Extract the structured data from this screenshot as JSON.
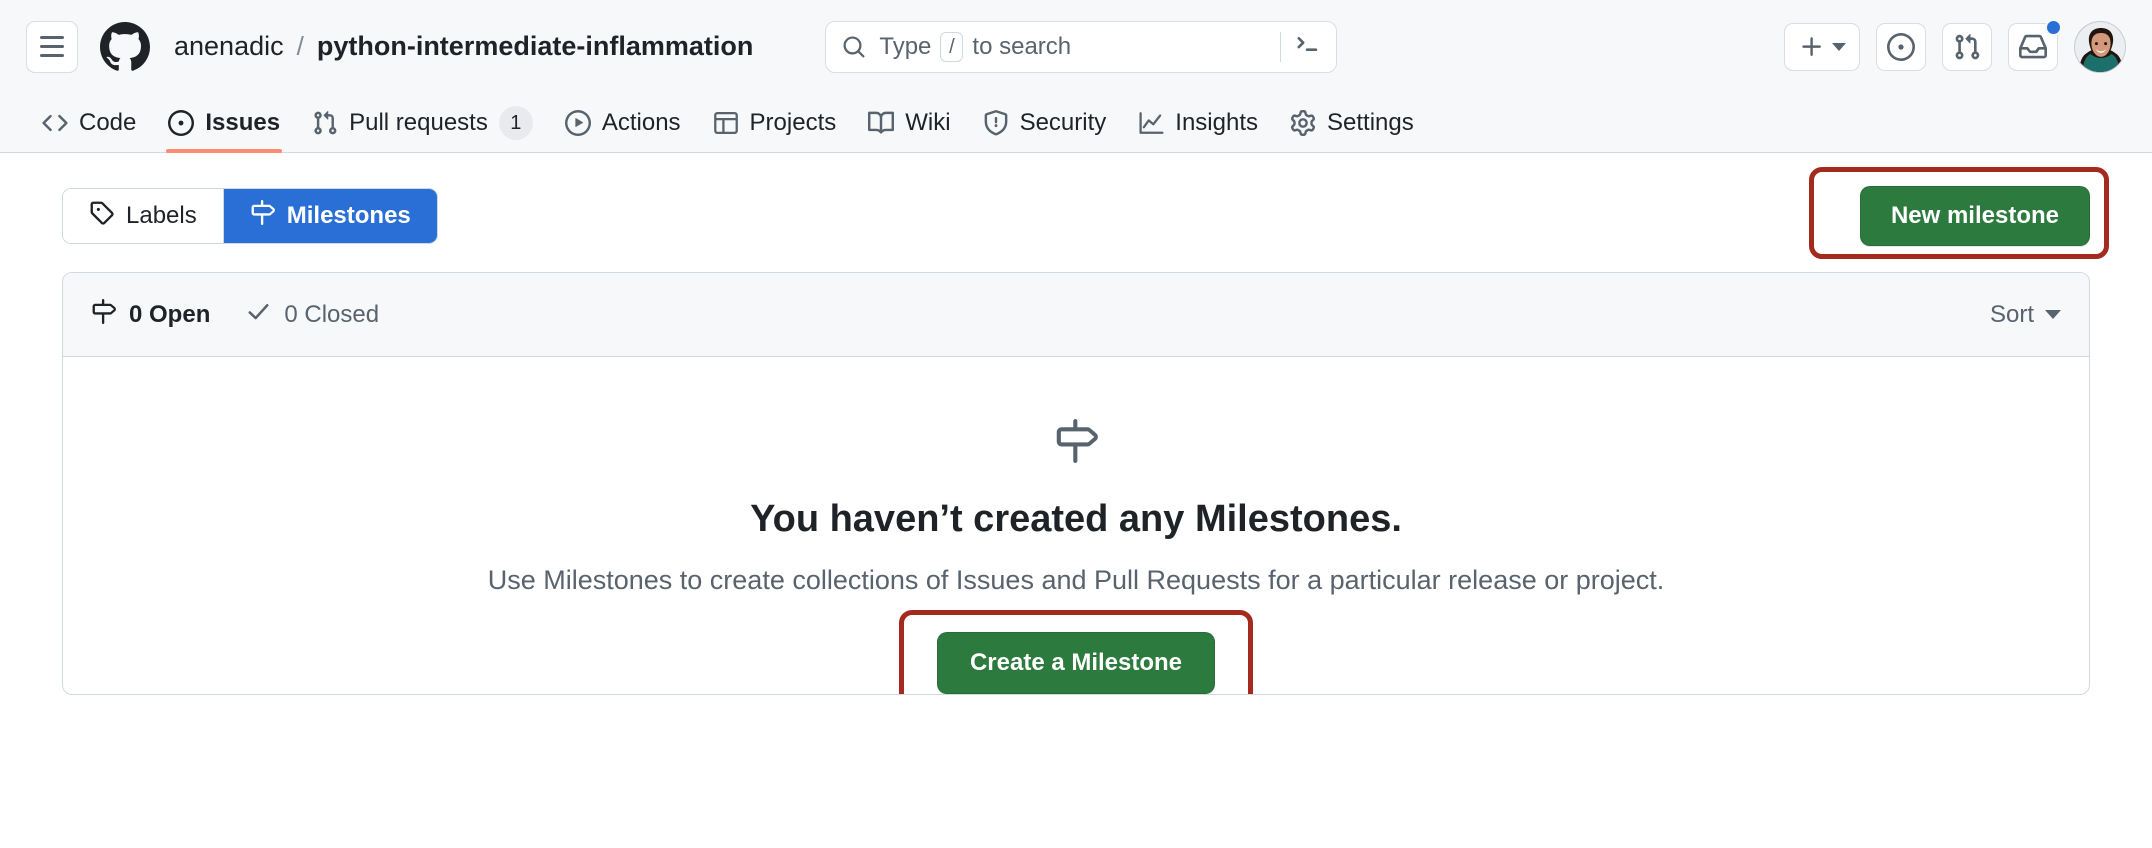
{
  "header": {
    "menu_icon": "hamburger-menu-icon",
    "logo_icon": "github-logo-icon",
    "owner": "anenadic",
    "separator": "/",
    "repo": "python-intermediate-inflammation",
    "search": {
      "icon": "search-icon",
      "placeholder_prefix": "Type",
      "slash_key": "/",
      "placeholder_suffix": "to search",
      "command_palette_icon": "terminal-icon"
    },
    "actions": {
      "create_new_icon": "plus-icon",
      "create_new_caret": "chevron-down-icon",
      "issues_icon": "issue-opened-icon",
      "pull_requests_icon": "git-pull-request-icon",
      "inbox_icon": "inbox-icon",
      "inbox_has_notification": true,
      "avatar": "user-avatar"
    }
  },
  "repo_nav": {
    "tabs": [
      {
        "label": "Code",
        "icon": "code-icon",
        "active": false,
        "badge": null
      },
      {
        "label": "Issues",
        "icon": "issue-opened-icon",
        "active": true,
        "badge": null
      },
      {
        "label": "Pull requests",
        "icon": "git-pull-request-icon",
        "active": false,
        "badge": "1"
      },
      {
        "label": "Actions",
        "icon": "play-icon",
        "active": false,
        "badge": null
      },
      {
        "label": "Projects",
        "icon": "table-icon",
        "active": false,
        "badge": null
      },
      {
        "label": "Wiki",
        "icon": "book-icon",
        "active": false,
        "badge": null
      },
      {
        "label": "Security",
        "icon": "shield-icon",
        "active": false,
        "badge": null
      },
      {
        "label": "Insights",
        "icon": "graph-icon",
        "active": false,
        "badge": null
      },
      {
        "label": "Settings",
        "icon": "gear-icon",
        "active": false,
        "badge": null
      }
    ]
  },
  "subnav": {
    "labels_tab": {
      "label": "Labels",
      "icon": "tag-icon",
      "active": false
    },
    "milestones_tab": {
      "label": "Milestones",
      "icon": "milestone-icon",
      "active": true
    },
    "new_milestone_button": "New milestone"
  },
  "filter_bar": {
    "open": {
      "label": "0 Open",
      "icon": "milestone-icon"
    },
    "closed": {
      "label": "0 Closed",
      "icon": "check-icon"
    },
    "sort": {
      "label": "Sort",
      "icon": "chevron-down-icon"
    }
  },
  "empty_state": {
    "icon": "milestone-icon",
    "title": "You haven’t created any Milestones.",
    "description": "Use Milestones to create collections of Issues and Pull Requests for a particular release or project.",
    "cta_label": "Create a Milestone"
  },
  "annotations": {
    "color": "#a32a1c",
    "targets": [
      "New milestone",
      "Create a Milestone"
    ]
  },
  "colors": {
    "accent_blue": "#2a6fd6",
    "green_button": "#2c7a3d",
    "active_tab_underline": "#fd8c73",
    "header_bg": "#f6f8fa",
    "border": "#d1d9e0",
    "text": "#1f2328",
    "muted_text": "#59636e",
    "annotation_red": "#a32a1c",
    "notification_dot": "#2a6fd6"
  }
}
